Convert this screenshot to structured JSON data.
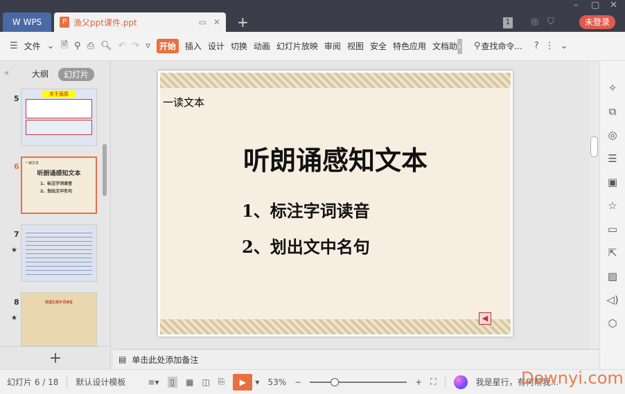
{
  "titlebar": {
    "wps_label": "WPS",
    "doc_tab": "渔父ppt课件.ppt",
    "new_tab": "+",
    "badge": "1",
    "login": "未登录"
  },
  "toolbar": {
    "menu": "文件",
    "tabs": [
      "开始",
      "插入",
      "设计",
      "切换",
      "动画",
      "幻灯片放映",
      "审阅",
      "视图",
      "安全",
      "特色应用",
      "文档助"
    ],
    "search": "查找命令..."
  },
  "leftpanel": {
    "tab_outline": "大纲",
    "tab_slides": "幻灯片",
    "thumbs": [
      {
        "num": "5",
        "title": "关于屈原"
      },
      {
        "num": "6",
        "title": "听朗诵感知文本",
        "lines": [
          "1、标注字词读音",
          "2、划出文中名句"
        ],
        "label": "一读文本"
      },
      {
        "num": "7",
        "title": ""
      },
      {
        "num": "8",
        "title": "梳理生疏字词读音"
      }
    ]
  },
  "slide": {
    "label": "一读文本",
    "title": "听朗诵感知文本",
    "bullets": [
      "1、标注字词读音",
      "2、划出文中名句"
    ]
  },
  "notes": {
    "placeholder": "单击此处添加备注"
  },
  "status": {
    "slide_counter": "幻灯片 6 / 18",
    "template": "默认设计模板",
    "zoom": "53%",
    "ai_text": "我是星行，有何帮我..."
  },
  "watermark": "Downyi.com"
}
